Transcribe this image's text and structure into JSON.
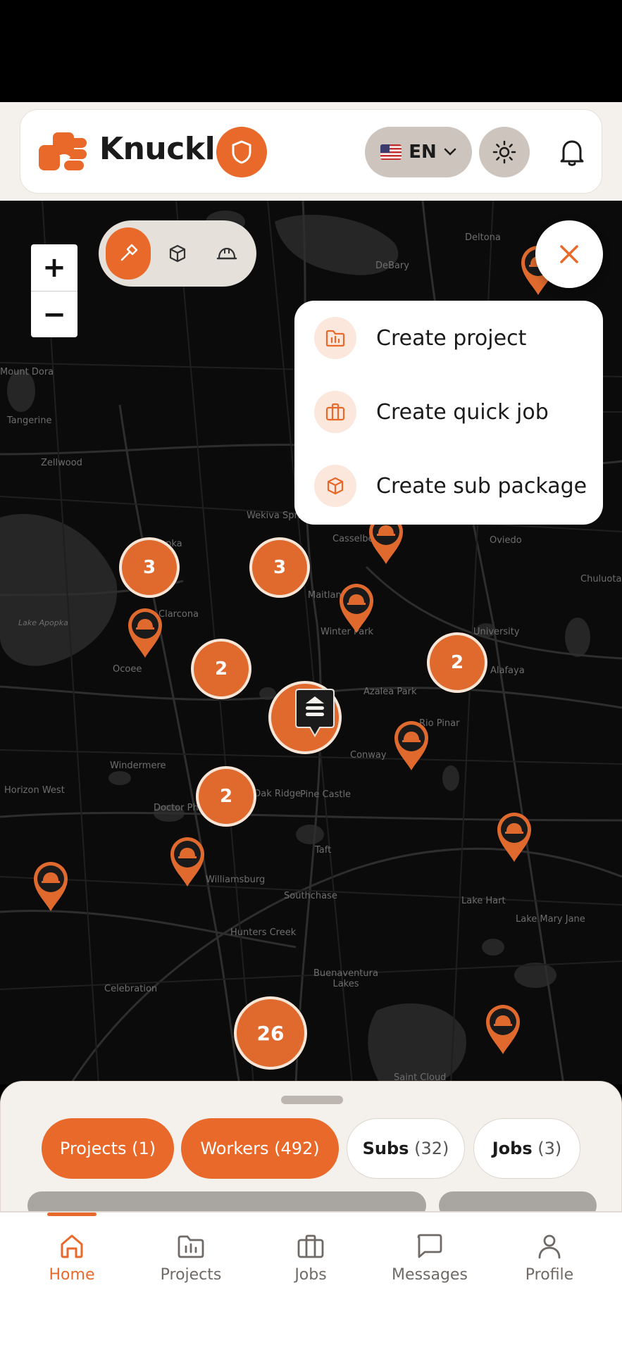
{
  "app": {
    "name": "Knuckl"
  },
  "header": {
    "language": {
      "code": "EN",
      "flag": "us-flag-icon"
    },
    "icons": [
      "shield-icon",
      "sun-icon",
      "bell-icon"
    ]
  },
  "map": {
    "zoom_in": "+",
    "zoom_out": "−",
    "filter_modes": [
      "hammer-icon",
      "package-icon",
      "hardhat-icon"
    ],
    "place_names": [
      "Deltona",
      "DeBary",
      "Mount Dora",
      "Tangerine",
      "Zellwood",
      "Wekiva Springs",
      "Apopka",
      "Casselberry",
      "Oviedo",
      "Chuluota",
      "Lake Apopka",
      "Clarcona",
      "Maitland",
      "Winter Park",
      "University",
      "Ocoee",
      "Alafaya",
      "Azalea Park",
      "Rio Pinar",
      "Windermere",
      "Conway",
      "Horizon West",
      "Doctor Phillips",
      "Oak Ridge",
      "Pine Castle",
      "Taft",
      "Williamsburg",
      "Southchase",
      "Lake Hart",
      "Lake Mary Jane",
      "Hunters Creek",
      "Buenaventura Lakes",
      "Celebration",
      "Saint Cloud"
    ],
    "clusters": [
      {
        "id": "c1",
        "count": "3"
      },
      {
        "id": "c2",
        "count": "3"
      },
      {
        "id": "c3",
        "count": "2"
      },
      {
        "id": "c4",
        "count": "2"
      },
      {
        "id": "c5",
        "count": "2"
      },
      {
        "id": "c6",
        "count": "26"
      }
    ]
  },
  "create_menu": {
    "items": [
      {
        "label": "Create project",
        "icon": "folder-icon"
      },
      {
        "label": "Create quick job",
        "icon": "briefcase-icon"
      },
      {
        "label": "Create sub package",
        "icon": "package-icon"
      }
    ]
  },
  "sheet": {
    "chips": [
      {
        "label": "Projects (1)",
        "active": true
      },
      {
        "label": "Workers (492)",
        "active": true
      },
      {
        "label": "Subs",
        "count": "(32)",
        "active": false
      },
      {
        "label": "Jobs",
        "count": "(3)",
        "active": false
      }
    ]
  },
  "bottom_nav": {
    "items": [
      {
        "label": "Home",
        "icon": "home-icon",
        "active": true
      },
      {
        "label": "Projects",
        "icon": "projects-icon",
        "active": false
      },
      {
        "label": "Jobs",
        "icon": "briefcase-icon",
        "active": false
      },
      {
        "label": "Messages",
        "icon": "chat-icon",
        "active": false
      },
      {
        "label": "Profile",
        "icon": "person-icon",
        "active": false
      }
    ]
  },
  "colors": {
    "accent": "#e8692a",
    "map_bg": "#0b0b0b",
    "surface": "#f4f0ec"
  }
}
